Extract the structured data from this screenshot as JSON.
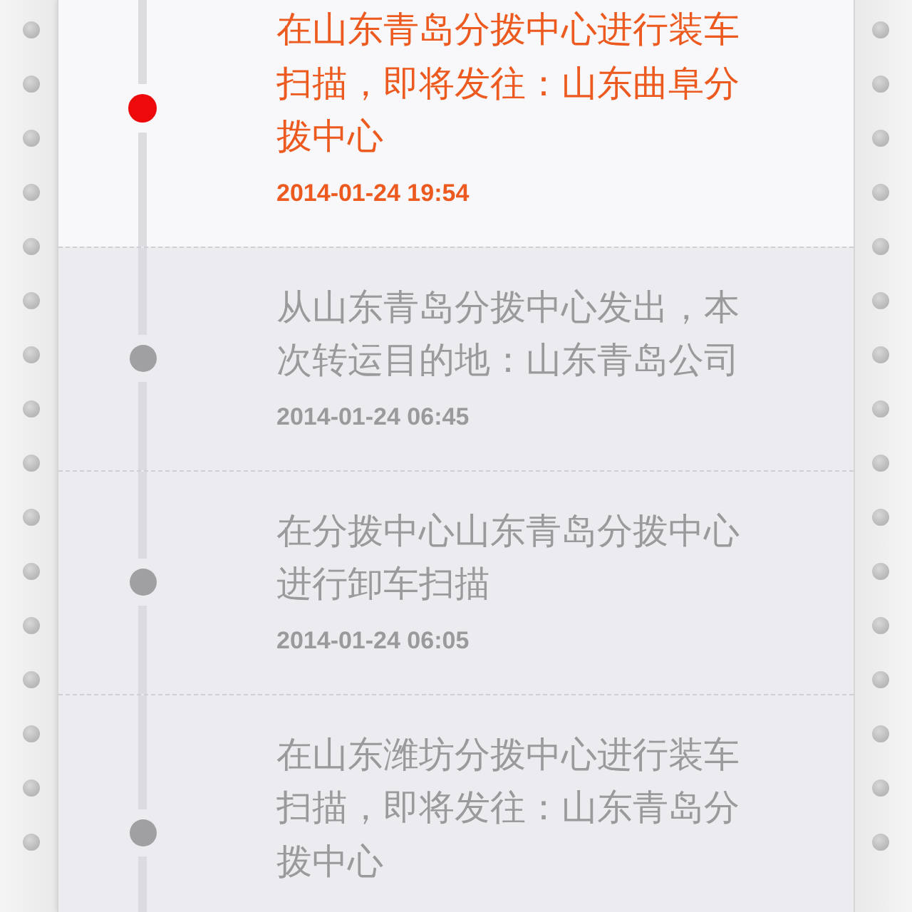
{
  "events": [
    {
      "text": "在山东青岛分拨中心进行装车扫描，即将发往：山东曲阜分拨中心",
      "time": "2014-01-24 19:54",
      "current": true
    },
    {
      "text": "从山东青岛分拨中心发出，本次转运目的地：山东青岛公司",
      "time": "2014-01-24 06:45",
      "current": false
    },
    {
      "text": "在分拨中心山东青岛分拨中心进行卸车扫描",
      "time": "2014-01-24 06:05",
      "current": false
    },
    {
      "text": "在山东潍坊分拨中心进行装车扫描，即将发往：山东青岛分拨中心",
      "current": false
    }
  ]
}
